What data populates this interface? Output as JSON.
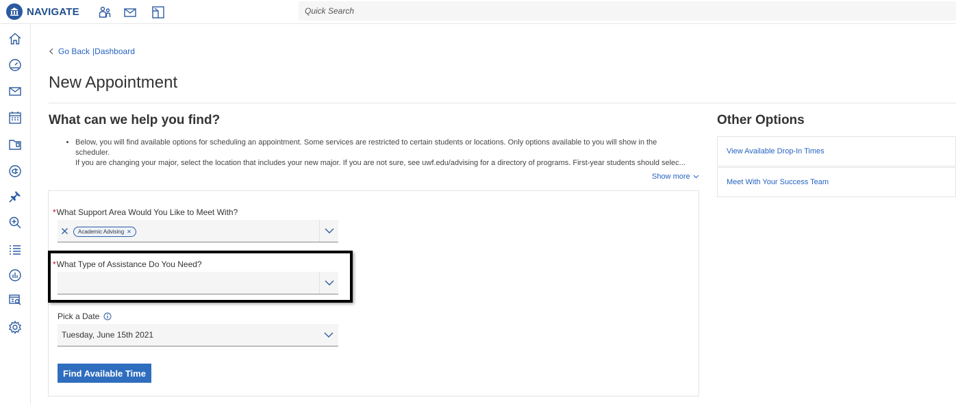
{
  "app": {
    "name": "NAVIGATE"
  },
  "search": {
    "placeholder": "Quick Search"
  },
  "breadcrumb": {
    "back_label": "Go Back",
    "separator": "|",
    "current": "Dashboard"
  },
  "page": {
    "title": "New Appointment"
  },
  "help": {
    "title": "What can we help you find?",
    "bullets": [
      "Below, you will find available options for scheduling an appointment. Some services are restricted to certain students or locations. Only options available to you will show in the scheduler.",
      "If you are changing your major, select the location that includes your new major. If you are not sure, see uwf.edu/advising for a directory of programs. First-year students should selec..."
    ],
    "show_more": "Show more"
  },
  "form": {
    "support_area": {
      "label": "What Support Area Would You Like to Meet With?",
      "required": "*",
      "selected_chip": "Academic Advising"
    },
    "assistance_type": {
      "label": "What Type of Assistance Do You Need?",
      "required": "*",
      "value": ""
    },
    "date": {
      "label": "Pick a Date",
      "value": "Tuesday, June 15th 2021"
    },
    "submit_label": "Find Available Time"
  },
  "other_options": {
    "title": "Other Options",
    "items": [
      {
        "label": "View Available Drop-In Times"
      },
      {
        "label": "Meet With Your Success Team"
      }
    ]
  },
  "colors": {
    "brand": "#1f4e8c",
    "link": "#2563c0",
    "primary_button": "#2f6dbf",
    "required": "#d0021b"
  },
  "icons": {
    "top": [
      "students-icon",
      "mail-icon",
      "split-view-icon"
    ],
    "sidebar": [
      "home-icon",
      "dashboard-icon",
      "mail-icon",
      "calendar-icon",
      "folder-icon",
      "megaphone-icon",
      "pin-icon",
      "search-zoom-icon",
      "list-icon",
      "analytics-icon",
      "reports-icon",
      "settings-icon"
    ]
  }
}
